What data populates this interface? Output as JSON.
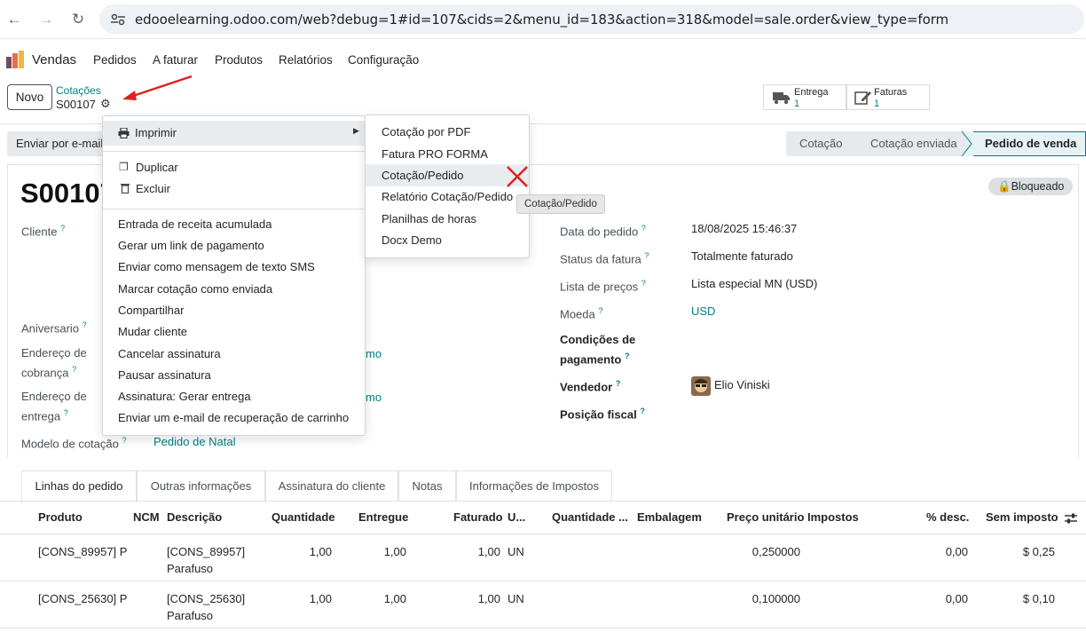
{
  "browser": {
    "url": "edooelearning.odoo.com/web?debug=1#id=107&cids=2&menu_id=183&action=318&model=sale.order&view_type=form"
  },
  "nav": {
    "app": "Vendas",
    "items": [
      "Pedidos",
      "A faturar",
      "Produtos",
      "Relatórios",
      "Configuração"
    ]
  },
  "control": {
    "new_button": "Novo",
    "breadcrumb_parent": "Cotações",
    "record_name": "S00107",
    "action_send": "Enviar por e-mail",
    "smart_buttons": [
      {
        "label": "Entrega",
        "value": "1"
      },
      {
        "label": "Faturas",
        "value": "1"
      }
    ],
    "stages": [
      "Cotação",
      "Cotação enviada",
      "Pedido de venda"
    ]
  },
  "gear_menu": {
    "print": "Imprimir",
    "duplicate": "Duplicar",
    "delete": "Excluir",
    "actions": [
      "Entrada de receita acumulada",
      "Gerar um link de pagamento",
      "Enviar como mensagem de texto SMS",
      "Marcar cotação como enviada",
      "Compartilhar",
      "Mudar cliente",
      "Cancelar assinatura",
      "Pausar assinatura",
      "Assinatura: Gerar entrega",
      "Enviar um e-mail de recuperação de carrinho"
    ]
  },
  "print_menu": {
    "items": [
      "Cotação por PDF",
      "Fatura PRO FORMA",
      "Cotação/Pedido",
      "Relatório Cotação/Pedido",
      "Planilhas de horas",
      "Docx Demo"
    ],
    "tooltip": "Cotação/Pedido"
  },
  "form": {
    "title": "S00107",
    "status_badge": "Bloqueado",
    "left": {
      "cliente": "Cliente",
      "aniversario": "Aniversario",
      "cobranca": [
        "Endereço de",
        "cobrança"
      ],
      "entrega": [
        "Endereço de",
        "entrega"
      ],
      "modelo": "Modelo de cotação",
      "modelo_value": "Pedido de Natal",
      "partial_addr1": "mo",
      "partial_addr2": "mo"
    },
    "right": {
      "data_label": "Data do pedido",
      "data_value": "18/08/2025 15:46:37",
      "status_label": "Status da fatura",
      "status_value": "Totalmente faturado",
      "lista_label": "Lista de preços",
      "lista_value": "Lista especial MN (USD)",
      "moeda_label": "Moeda",
      "moeda_value": "USD",
      "cond_label": [
        "Condições de",
        "pagamento"
      ],
      "vendedor_label": "Vendedor",
      "vendedor_value": "Elio Viniski",
      "posicao_label": "Posição fiscal"
    }
  },
  "tabs": [
    "Linhas do pedido",
    "Outras informações",
    "Assinatura do cliente",
    "Notas",
    "Informações de Impostos"
  ],
  "table": {
    "headers": [
      "Produto",
      "NCM",
      "Descrição",
      "Quantidade",
      "Entregue",
      "Faturado",
      "U...",
      "Quantidade ...",
      "Embalagem",
      "Preço unitário",
      "Impostos",
      "% desc.",
      "Sem imposto"
    ],
    "rows": [
      {
        "produto": "[CONS_89957] P",
        "desc1": "[CONS_89957]",
        "desc2": "Parafuso",
        "qtd": "1,00",
        "entregue": "1,00",
        "faturado": "1,00",
        "un": "UN",
        "preco": "0,250000",
        "desc": "0,00",
        "total": "$ 0,25"
      },
      {
        "produto": "[CONS_25630] P",
        "desc1": "[CONS_25630]",
        "desc2": "Parafuso",
        "qtd": "1,00",
        "entregue": "1,00",
        "faturado": "1,00",
        "un": "UN",
        "preco": "0,100000",
        "desc": "0,00",
        "total": "$ 0,10"
      }
    ]
  },
  "colors": {
    "accent": "#017e84",
    "brand": "#714b67",
    "annotation": "#e02020"
  }
}
